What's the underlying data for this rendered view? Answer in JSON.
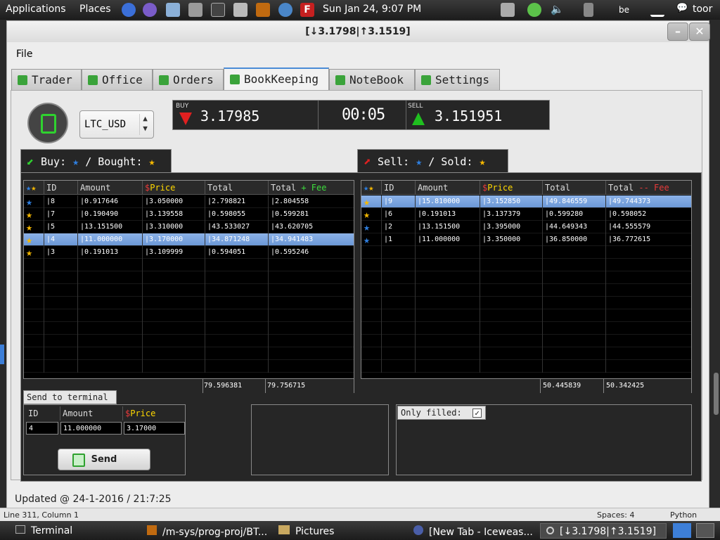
{
  "panel": {
    "applications": "Applications",
    "places": "Places",
    "clock": "Sun Jan 24,  9:07 PM",
    "keyboard": "be",
    "user": "toor"
  },
  "window": {
    "title": "[↓3.1798|↑3.1519]",
    "minimize": "–",
    "close": "✕",
    "menu_file": "File"
  },
  "tabs": [
    {
      "label": "Trader"
    },
    {
      "label": "Office"
    },
    {
      "label": "Orders"
    },
    {
      "label": "BookKeeping"
    },
    {
      "label": "NoteBook"
    },
    {
      "label": "Settings"
    }
  ],
  "pair": "LTC_USD",
  "ticker": {
    "buy_label": "BUY",
    "buy_value": "3.17985",
    "timer": "00:05",
    "sell_label": "SELL",
    "sell_value": "3.151951"
  },
  "buy_pane": {
    "header_a": "Buy:",
    "header_b": "/ Bought:",
    "columns": [
      "ID",
      "Amount",
      "Price",
      "Total",
      "Total",
      "+ Fee"
    ],
    "rows": [
      {
        "status": "blue",
        "id": "8",
        "amount": "0.917646",
        "price": "3.050000",
        "total": "2.798821",
        "total_fee": "2.804558"
      },
      {
        "status": "gold",
        "id": "7",
        "amount": "0.190490",
        "price": "3.139558",
        "total": "0.598055",
        "total_fee": "0.599281"
      },
      {
        "status": "gold",
        "id": "5",
        "amount": "13.151500",
        "price": "3.310000",
        "total": "43.533027",
        "total_fee": "43.620705"
      },
      {
        "status": "gold",
        "id": "4",
        "amount": "11.000000",
        "price": "3.170000",
        "total": "34.871248",
        "total_fee": "34.941483",
        "selected": true
      },
      {
        "status": "gold",
        "id": "3",
        "amount": "0.191013",
        "price": "3.109999",
        "total": "0.594051",
        "total_fee": "0.595246"
      }
    ],
    "sum_total": "79.596381",
    "sum_total_fee": "79.756715"
  },
  "sell_pane": {
    "header_a": "Sell:",
    "header_b": "/ Sold:",
    "columns": [
      "ID",
      "Amount",
      "Price",
      "Total",
      "Total",
      "-- Fee"
    ],
    "rows": [
      {
        "status": "gold",
        "id": "9",
        "amount": "15.810000",
        "price": "3.152850",
        "total": "49.846559",
        "total_fee": "49.744373",
        "selected": true
      },
      {
        "status": "gold",
        "id": "6",
        "amount": "0.191013",
        "price": "3.137379",
        "total": "0.599280",
        "total_fee": "0.598052"
      },
      {
        "status": "blue",
        "id": "2",
        "amount": "13.151500",
        "price": "3.395000",
        "total": "44.649343",
        "total_fee": "44.555579"
      },
      {
        "status": "blue",
        "id": "1",
        "amount": "11.000000",
        "price": "3.350000",
        "total": "36.850000",
        "total_fee": "36.772615"
      }
    ],
    "sum_total": "50.445839",
    "sum_total_fee": "50.342425"
  },
  "send_terminal": {
    "title": "Send to terminal",
    "col_id": "ID",
    "col_amount": "Amount",
    "col_price": "Price",
    "id_value": "4",
    "amount_value": "11.000000",
    "price_value": "3.17000",
    "send_label": "Send"
  },
  "only_filled_label": "Only filled:",
  "updated": "Updated @ 24-1-2016 / 21:7:25",
  "editor_status": {
    "position": "Line 311, Column 1",
    "spaces": "Spaces: 4",
    "language": "Python"
  },
  "taskbar": [
    {
      "label": "Terminal"
    },
    {
      "label": "/m-sys/prog-proj/BT..."
    },
    {
      "label": "Pictures"
    },
    {
      "label": "[New Tab - Iceweas..."
    },
    {
      "label": "[↓3.1798|↑3.1519]"
    }
  ],
  "colors": {
    "star_gold": "#f5b800",
    "star_blue": "#2f7fe0",
    "price_yellow": "#ffd800",
    "fee_plus_green": "#3ddc3d",
    "fee_minus_red": "#e83a3a",
    "selection_blue": "#7aa6e0"
  }
}
